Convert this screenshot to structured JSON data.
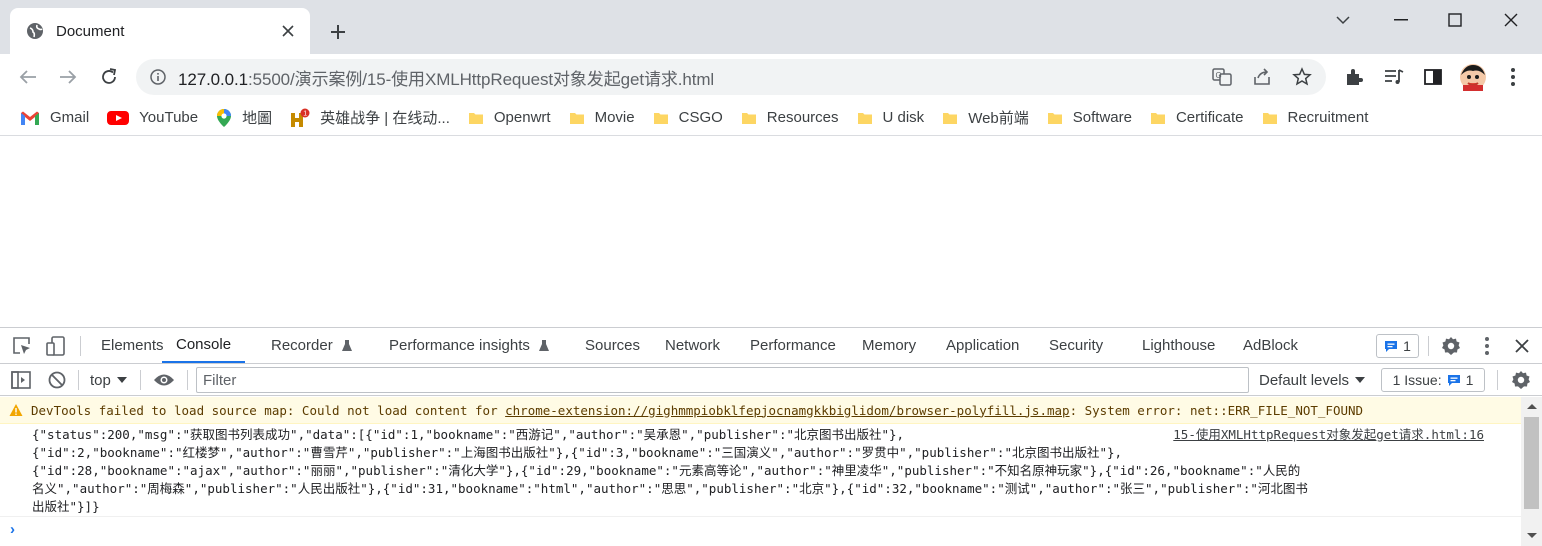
{
  "browser": {
    "tab_title": "Document",
    "url_host": "127.0.0.1",
    "url_path": ":5500/演示案例/15-使用XMLHttpRequest对象发起get请求.html"
  },
  "bookmarks": [
    {
      "label": "Gmail",
      "icon": "gmail-icon"
    },
    {
      "label": "YouTube",
      "icon": "youtube-icon"
    },
    {
      "label": "地圖",
      "icon": "maps-icon"
    },
    {
      "label": "英雄战争 | 在线动...",
      "icon": "game-icon"
    },
    {
      "label": "Openwrt",
      "icon": "folder-icon"
    },
    {
      "label": "Movie",
      "icon": "folder-icon"
    },
    {
      "label": "CSGO",
      "icon": "folder-icon"
    },
    {
      "label": "Resources",
      "icon": "folder-icon"
    },
    {
      "label": "U disk",
      "icon": "folder-icon"
    },
    {
      "label": "Web前端",
      "icon": "folder-icon"
    },
    {
      "label": "Software",
      "icon": "folder-icon"
    },
    {
      "label": "Certificate",
      "icon": "folder-icon"
    },
    {
      "label": "Recruitment",
      "icon": "folder-icon"
    }
  ],
  "devtools": {
    "tabs": [
      "Elements",
      "Console",
      "Recorder",
      "Performance insights",
      "Sources",
      "Network",
      "Performance",
      "Memory",
      "Application",
      "Security",
      "Lighthouse",
      "AdBlock"
    ],
    "active_tab": "Console",
    "issues_count": "1",
    "context": "top",
    "filter_placeholder": "Filter",
    "levels": "Default levels",
    "issue_counter_label": "1 Issue:",
    "issue_counter_count": "1"
  },
  "console": {
    "warning_prefix": "DevTools failed to load source map: Could not load content for ",
    "warning_link": "chrome-extension://gighmmpiobklfepjocnamgkkbiglidom/browser-polyfill.js.map",
    "warning_suffix": ": System error: net::ERR_FILE_NOT_FOUND",
    "log_source": "15-使用XMLHttpRequest对象发起get请求.html:16",
    "log_lines": [
      "{\"status\":200,\"msg\":\"获取图书列表成功\",\"data\":[{\"id\":1,\"bookname\":\"西游记\",\"author\":\"吴承恩\",\"publisher\":\"北京图书出版社\"},",
      "{\"id\":2,\"bookname\":\"红楼梦\",\"author\":\"曹雪芹\",\"publisher\":\"上海图书出版社\"},{\"id\":3,\"bookname\":\"三国演义\",\"author\":\"罗贯中\",\"publisher\":\"北京图书出版社\"},",
      "{\"id\":28,\"bookname\":\"ajax\",\"author\":\"丽丽\",\"publisher\":\"清化大学\"},{\"id\":29,\"bookname\":\"元素高等论\",\"author\":\"神里凌华\",\"publisher\":\"不知名原神玩家\"},{\"id\":26,\"bookname\":\"人民的",
      "名义\",\"author\":\"周梅森\",\"publisher\":\"人民出版社\"},{\"id\":31,\"bookname\":\"html\",\"author\":\"思思\",\"publisher\":\"北京\"},{\"id\":32,\"bookname\":\"测试\",\"author\":\"张三\",\"publisher\":\"河北图书",
      "出版社\"}]}"
    ]
  },
  "colors": {
    "accent": "#1a73e8",
    "warning_bg": "#fffbe5",
    "titlebar": "#dee1e6"
  }
}
